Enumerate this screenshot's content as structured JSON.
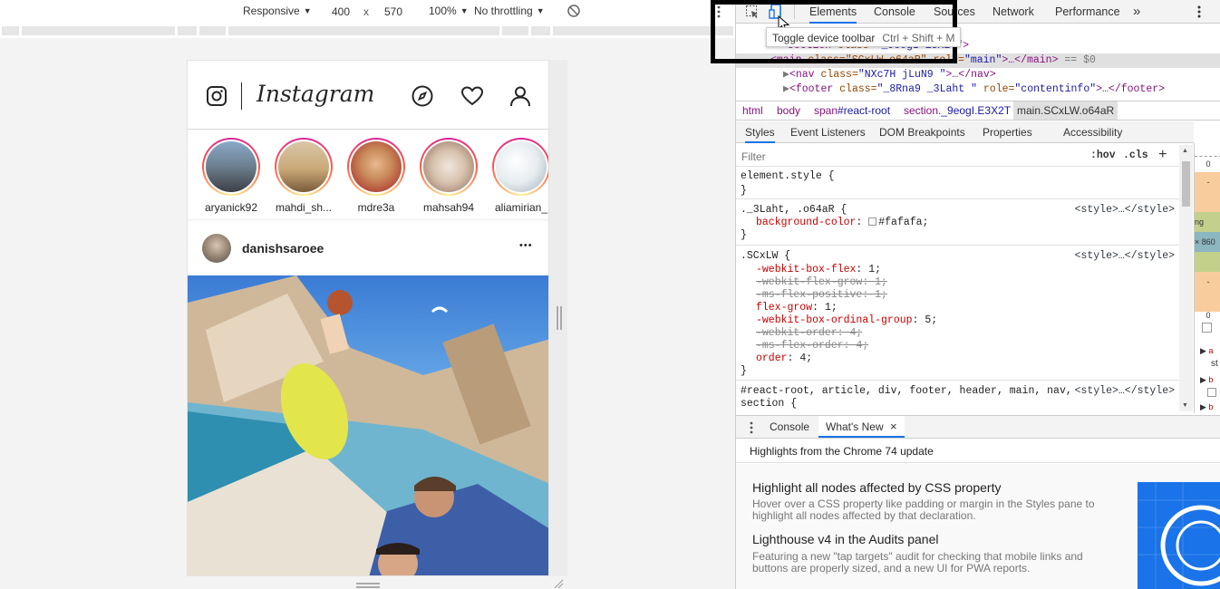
{
  "device_toolbar": {
    "mode": "Responsive",
    "width": "400",
    "times": "x",
    "height": "570",
    "zoom": "100%",
    "throttle": "No throttling"
  },
  "instagram": {
    "logo_text": "Instagram",
    "stories": [
      {
        "name": "aryanick92"
      },
      {
        "name": "mahdi_sh..."
      },
      {
        "name": "mdre3a"
      },
      {
        "name": "mahsah94"
      },
      {
        "name": "aliamirian_"
      }
    ],
    "post": {
      "username": "danishsaroee",
      "more": "•••"
    }
  },
  "devtools": {
    "tabs": [
      "Elements",
      "Console",
      "Sources",
      "Network",
      "Performance"
    ],
    "more_tabs": "»",
    "tooltip": {
      "label": "Toggle device toolbar",
      "shortcut": "Ctrl + Shift + M"
    },
    "dom": {
      "line0": {
        "tag": "<section",
        "attr": "class=",
        "val": "\"_9eogI E3X2T\"",
        "end": ">"
      },
      "line1": {
        "tag": "<main",
        "attr": "class=\"SCxLW o64aR\" role=",
        "val": "\"main\"",
        "end": ">…</main>",
        "eq": "== $0"
      },
      "line2": {
        "tag": "<nav",
        "attr": " class=",
        "val": "\"NXc7H jLuN9  \"",
        "end": ">…</nav>"
      },
      "line3": {
        "tag": "<footer",
        "attr": " class=",
        "val": "\"_8Rna9  _3Laht \"",
        "attr2": " role=",
        "val2": "\"contentinfo\"",
        "end": ">…</footer>"
      }
    },
    "breadcrumbs": [
      {
        "tag": "html",
        "cls": ""
      },
      {
        "tag": "body",
        "cls": ""
      },
      {
        "tag": "span",
        "cls": "#react-root"
      },
      {
        "tag": "section",
        "cls": "._9eogI.E3X2T"
      },
      {
        "tag": "main",
        "cls": ".SCxLW.o64aR"
      }
    ],
    "subtabs": [
      "Styles",
      "Event Listeners",
      "DOM Breakpoints",
      "Properties",
      "Accessibility"
    ],
    "filter": {
      "placeholder": "Filter",
      "hov": ":hov",
      "cls": ".cls",
      "add": "+"
    },
    "styles": {
      "r0": {
        "sel": "element.style {",
        "close": "}"
      },
      "r1": {
        "sel": "._3Laht, .o64aR {",
        "src": "<style>…</style>",
        "p0n": "background-color",
        "p0v": "#fafafa;",
        "close": "}"
      },
      "r2": {
        "sel": ".SCxLW {",
        "src": "<style>…</style>",
        "props": [
          {
            "n": "-webkit-box-flex",
            "v": "1;",
            "strike": false
          },
          {
            "n": "-webkit-flex-grow",
            "v": "1;",
            "strike": true
          },
          {
            "n": "-ms-flex-positive",
            "v": "1;",
            "strike": true
          },
          {
            "n": "flex-grow",
            "v": "1;",
            "strike": false
          },
          {
            "n": "-webkit-box-ordinal-group",
            "v": "5;",
            "strike": false
          },
          {
            "n": "-webkit-order",
            "v": "4;",
            "strike": true
          },
          {
            "n": "-ms-flex-order",
            "v": "4;",
            "strike": true
          },
          {
            "n": "order",
            "v": "4;",
            "strike": false
          }
        ],
        "close": "}"
      },
      "r3": {
        "sel": "#react-root, article, div, footer, header, main, nav,",
        "sel2": "section {",
        "src": "<style>…</style>"
      }
    },
    "boxmodel": {
      "zero": "0",
      "dash": "-",
      "dims": "× 860",
      "dash2": "-",
      "zero2": "0"
    },
    "drawer": {
      "tab1": "Console",
      "tab2": "What's New",
      "close": "×"
    },
    "whats_new": {
      "heading": "Highlights from the Chrome 74 update",
      "items": [
        {
          "title": "Highlight all nodes affected by CSS property",
          "desc": "Hover over a CSS property like padding or margin in the Styles pane to highlight all nodes affected by that declaration."
        },
        {
          "title": "Lighthouse v4 in the Audits panel",
          "desc": "Featuring a new \"tap targets\" audit for checking that mobile links and buttons are properly sized, and a new UI for PWA reports."
        }
      ]
    }
  }
}
